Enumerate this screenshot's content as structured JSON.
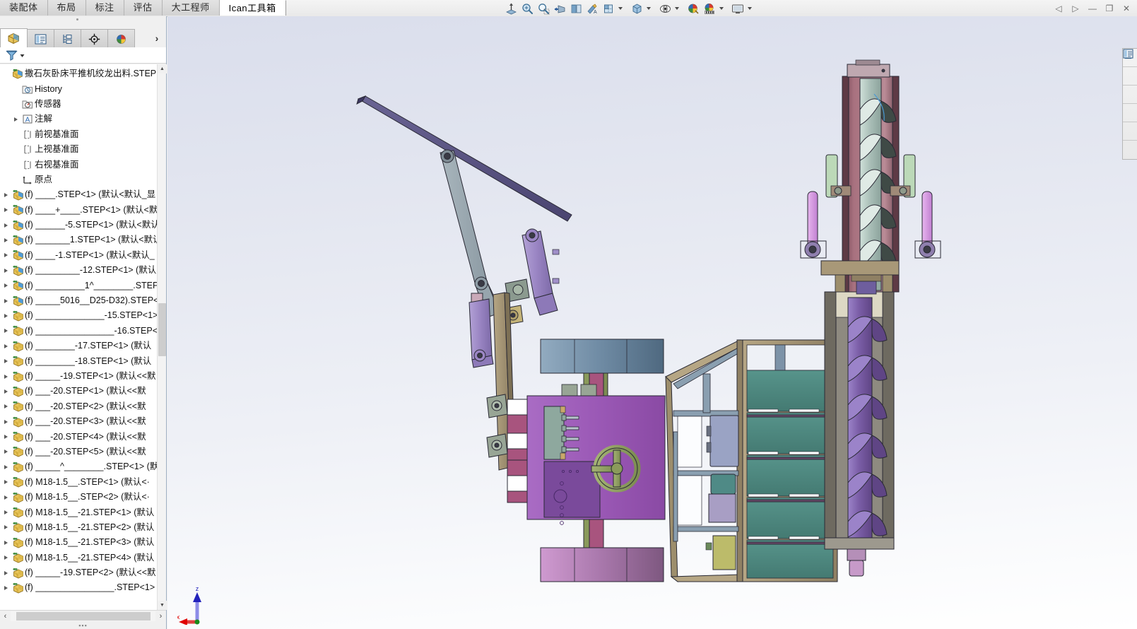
{
  "window": {
    "controls": [
      {
        "name": "pin-left-button",
        "glyph": "◁"
      },
      {
        "name": "pin-right-button",
        "glyph": "▷"
      },
      {
        "name": "minimize-button",
        "glyph": "—"
      },
      {
        "name": "restore-button",
        "glyph": "❐"
      },
      {
        "name": "close-button",
        "glyph": "✕"
      }
    ]
  },
  "ribbon": {
    "tabs": [
      {
        "label": "装配体",
        "active": false
      },
      {
        "label": "布局",
        "active": false
      },
      {
        "label": "标注",
        "active": false
      },
      {
        "label": "评估",
        "active": false
      },
      {
        "label": "大工程师",
        "active": false
      },
      {
        "label": "Ican工具箱",
        "active": true
      }
    ],
    "toolbar_icons": [
      {
        "name": "zoom-to-fit-icon",
        "label": "整屏显示全图"
      },
      {
        "name": "zoom-area-icon",
        "label": "局部放大"
      },
      {
        "name": "zoom-in-out-icon",
        "label": "放大缩小"
      },
      {
        "name": "previous-view-icon",
        "label": "上一视图"
      },
      {
        "name": "section-view-icon",
        "label": "剖面视图"
      },
      {
        "name": "view-orientation-icon",
        "label": "视图定向"
      },
      {
        "name": "display-style-icon",
        "label": "显示样式"
      },
      {
        "name": "hide-show-items-icon",
        "label": "隐藏/显示项目"
      },
      {
        "name": "edit-appearance-icon",
        "label": "编辑外观"
      },
      {
        "name": "apply-scene-icon",
        "label": "应用布景"
      },
      {
        "name": "view-settings-icon",
        "label": "视图设定"
      }
    ]
  },
  "feature_manager": {
    "tabs": [
      {
        "name": "feature-tree-tab",
        "label": "FeatureManager 设计树",
        "active": true
      },
      {
        "name": "property-manager-tab",
        "label": "PropertyManager",
        "active": false
      },
      {
        "name": "configuration-manager-tab",
        "label": "ConfigurationManager",
        "active": false
      },
      {
        "name": "dimxpert-manager-tab",
        "label": "DimXpertManager",
        "active": false
      },
      {
        "name": "display-manager-tab",
        "label": "DisplayManager",
        "active": false
      }
    ],
    "more_tabs_glyph": "›",
    "filter_label": "过滤器",
    "tree": [
      {
        "indent": 0,
        "arrow": false,
        "icon": "assembly-icon",
        "label": "撒石灰卧床平推机绞龙出料.STEP  (默"
      },
      {
        "indent": 1,
        "arrow": false,
        "icon": "history-icon",
        "label": "History"
      },
      {
        "indent": 1,
        "arrow": false,
        "icon": "sensor-icon",
        "label": "传感器"
      },
      {
        "indent": 1,
        "arrow": true,
        "icon": "annotation-icon",
        "label": "注解"
      },
      {
        "indent": 1,
        "arrow": false,
        "icon": "plane-icon",
        "label": "前视基准面"
      },
      {
        "indent": 1,
        "arrow": false,
        "icon": "plane-icon",
        "label": "上视基准面"
      },
      {
        "indent": 1,
        "arrow": false,
        "icon": "plane-icon",
        "label": "右视基准面"
      },
      {
        "indent": 1,
        "arrow": false,
        "icon": "origin-icon",
        "label": "原点"
      },
      {
        "indent": 0,
        "arrow": true,
        "icon": "part-blue-icon",
        "label": "(f) ____.STEP<1> (默认<默认_显"
      },
      {
        "indent": 0,
        "arrow": true,
        "icon": "part-blue-icon",
        "label": "(f) ____+____.STEP<1> (默认<默"
      },
      {
        "indent": 0,
        "arrow": true,
        "icon": "part-blue-icon",
        "label": "(f) ______-5.STEP<1>  (默认<默认"
      },
      {
        "indent": 0,
        "arrow": true,
        "icon": "part-blue-icon",
        "label": "(f) _______1.STEP<1>  (默认<默认"
      },
      {
        "indent": 0,
        "arrow": true,
        "icon": "part-blue-icon",
        "label": "(f) ____-1.STEP<1> (默认<默认_"
      },
      {
        "indent": 0,
        "arrow": true,
        "icon": "part-blue-icon",
        "label": "(f) _________-12.STEP<1>  (默认"
      },
      {
        "indent": 0,
        "arrow": true,
        "icon": "part-blue-icon",
        "label": "(f) __________1^________.STEP"
      },
      {
        "indent": 0,
        "arrow": true,
        "icon": "part-blue-icon",
        "label": "(f) _____5016__D25-D32).STEP<"
      },
      {
        "indent": 0,
        "arrow": true,
        "icon": "part-yellow-icon",
        "label": "(f) ______________-15.STEP<1>"
      },
      {
        "indent": 0,
        "arrow": true,
        "icon": "part-yellow-icon",
        "label": "(f) ________________-16.STEP<1"
      },
      {
        "indent": 0,
        "arrow": true,
        "icon": "part-yellow-icon",
        "label": "(f) ________-17.STEP<1>  (默认"
      },
      {
        "indent": 0,
        "arrow": true,
        "icon": "part-yellow-icon",
        "label": "(f) ________-18.STEP<1>  (默认"
      },
      {
        "indent": 0,
        "arrow": true,
        "icon": "part-yellow-icon",
        "label": "(f) _____-19.STEP<1>  (默认<<默"
      },
      {
        "indent": 0,
        "arrow": true,
        "icon": "part-yellow-icon",
        "label": "(f) ___-20.STEP<1> (默认<<默"
      },
      {
        "indent": 0,
        "arrow": true,
        "icon": "part-yellow-icon",
        "label": "(f) ___-20.STEP<2> (默认<<默"
      },
      {
        "indent": 0,
        "arrow": true,
        "icon": "part-yellow-icon",
        "label": "(f) ___-20.STEP<3> (默认<<默"
      },
      {
        "indent": 0,
        "arrow": true,
        "icon": "part-yellow-icon",
        "label": "(f) ___-20.STEP<4> (默认<<默"
      },
      {
        "indent": 0,
        "arrow": true,
        "icon": "part-yellow-icon",
        "label": "(f) ___-20.STEP<5> (默认<<默"
      },
      {
        "indent": 0,
        "arrow": true,
        "icon": "part-yellow-icon",
        "label": "(f) _____^________.STEP<1>  (默"
      },
      {
        "indent": 0,
        "arrow": true,
        "icon": "part-yellow-icon",
        "label": "(f) M18-1.5__.STEP<1> (默认<·"
      },
      {
        "indent": 0,
        "arrow": true,
        "icon": "part-yellow-icon",
        "label": "(f) M18-1.5__.STEP<2> (默认<·"
      },
      {
        "indent": 0,
        "arrow": true,
        "icon": "part-yellow-icon",
        "label": "(f) M18-1.5__-21.STEP<1> (默认"
      },
      {
        "indent": 0,
        "arrow": true,
        "icon": "part-yellow-icon",
        "label": "(f) M18-1.5__-21.STEP<2> (默认"
      },
      {
        "indent": 0,
        "arrow": true,
        "icon": "part-yellow-icon",
        "label": "(f) M18-1.5__-21.STEP<3> (默认"
      },
      {
        "indent": 0,
        "arrow": true,
        "icon": "part-yellow-icon",
        "label": "(f) M18-1.5__-21.STEP<4> (默认"
      },
      {
        "indent": 0,
        "arrow": true,
        "icon": "part-yellow-icon",
        "label": "(f) _____-19.STEP<2> (默认<<默"
      },
      {
        "indent": 0,
        "arrow": true,
        "icon": "part-yellow-icon",
        "label": "(f) ________________.STEP<1>"
      }
    ]
  },
  "task_pane": [
    {
      "name": "solidworks-resources-button",
      "icon": "home-icon"
    },
    {
      "name": "design-library-button",
      "icon": "design-library-icon"
    },
    {
      "name": "file-explorer-button",
      "icon": "folder-icon"
    },
    {
      "name": "view-palette-button",
      "icon": "view-palette-icon"
    },
    {
      "name": "appearances-scenes-button",
      "icon": "appearances-icon"
    },
    {
      "name": "custom-properties-button",
      "icon": "custom-properties-icon"
    }
  ],
  "viewport": {
    "triad": {
      "z_label": "z",
      "x_label": "x",
      "z_color": "#2222bb",
      "x_color": "#e00000"
    },
    "model_title": "撒石灰卧床平推机绞龙出料",
    "background_top": "#dadeec",
    "background_bottom": "#ffffff",
    "colors": {
      "boom_beam": "#5b5585",
      "boom_arm": "#9aa8b0",
      "cylinder": "#9b86c4",
      "body_purple": "#9b59b6",
      "handwheel_green": "#8a9a5b",
      "top_plate_blue": "#7b93ad",
      "frame_tan": "#a89878",
      "panel_teal": "#4f8a82",
      "auger_housing": "#a0717f",
      "auger_flight": "#b9cfc7",
      "lower_auger": "#7b5ea7",
      "strut_pink": "#d99ede"
    }
  }
}
